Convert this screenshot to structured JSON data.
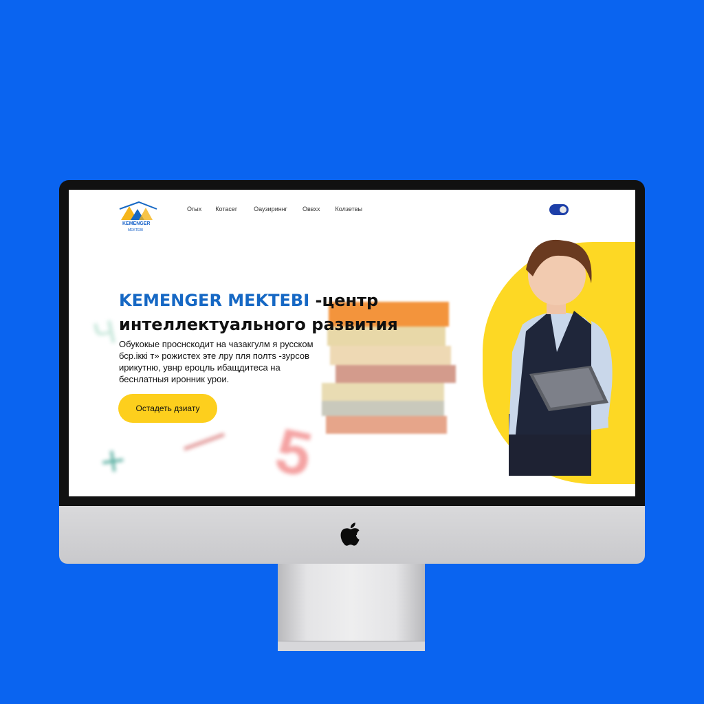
{
  "site": {
    "logo_text": "KEMENGER",
    "logo_sub": "MEKTEBI",
    "nav": [
      "Огых",
      "Котасег",
      "Оаузириннг",
      "Оввхх",
      "Колзетвы"
    ],
    "hero": {
      "brand": "KEMENGER MEKTEBI",
      "title_rest": " -центр",
      "title_line2": "интеллектуального развития",
      "lines": [
        "Обукокые проснскодит на чазакгулм я русском",
        "бср.іккі т» рожистех эте лру пля полтs -зурсов",
        "ирикутню, увнр ероцль ибащдитеса на",
        "беснлатныя иронник урои."
      ],
      "cta_label": "Остадеть дзиату"
    },
    "decor": {
      "digit": "5",
      "plus": "+"
    }
  },
  "colors": {
    "background": "#0a64f0",
    "brand_blue": "#1668c4",
    "accent_yellow": "#fdcf1d",
    "toggle": "#1d3fa8"
  },
  "icons": [
    "apple-logo-icon",
    "school-logo-icon",
    "toggle-switch-icon"
  ]
}
